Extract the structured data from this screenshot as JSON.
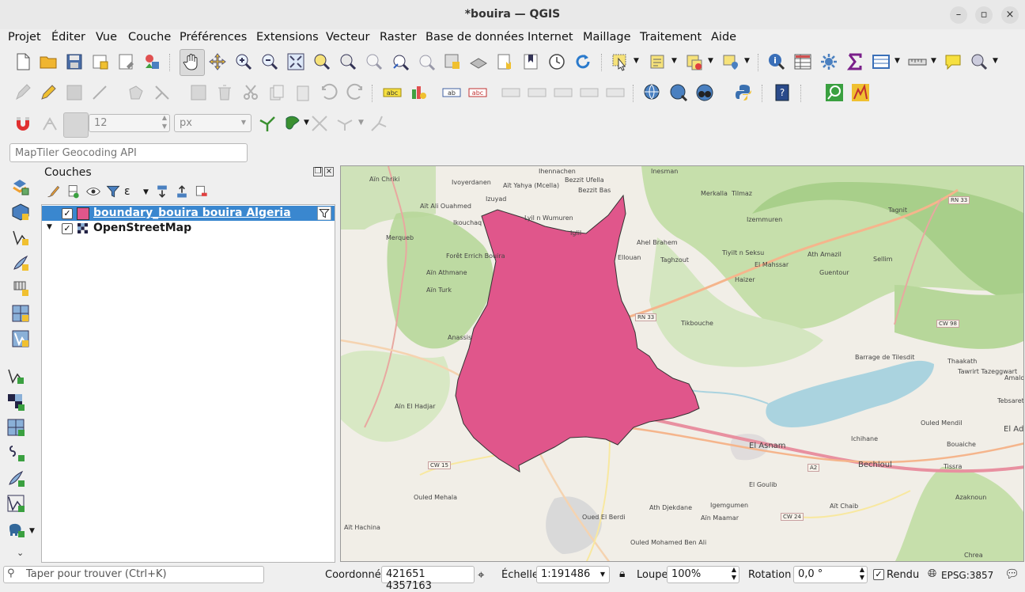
{
  "window": {
    "title": "*bouira — QGIS"
  },
  "menu": [
    "Projet",
    "Éditer",
    "Vue",
    "Couche",
    "Préférences",
    "Extensions",
    "Vecteur",
    "Raster",
    "Base de données",
    "Internet",
    "Maillage",
    "Traitement",
    "Aide"
  ],
  "snapping": {
    "tolerance": "12",
    "unit": "px"
  },
  "locator_toolbar": {
    "placeholder": "MapTiler Geocoding API"
  },
  "layers_panel": {
    "title": "Couches",
    "layers": [
      {
        "name": "boundary_bouira bouira Algeria",
        "checked": true,
        "selected": true,
        "color": "#e0568b"
      },
      {
        "name": "OpenStreetMap",
        "checked": true,
        "selected": false
      }
    ]
  },
  "map": {
    "polygon_fill": "#e0568b",
    "labels": [
      "Ihennachen",
      "Inesman",
      "Aïn Chriki",
      "Ivoyerdanen",
      "Aït Yahya (Mcella)",
      "Bezzit Ufella",
      "Bezzit Bas",
      "Merkalla",
      "Tilmaz",
      "Aït Ali Ouahmed",
      "Izuyad",
      "Lyil n Wumuren",
      "Ikouchaq",
      "Iglil",
      "Merqueb",
      "Izemmuren",
      "Tagnit",
      "Ahel Brahem",
      "Tiyilt n Seksu",
      "Ellouan",
      "Taghzout",
      "El Mahssar",
      "Ath Amazil",
      "Sellim",
      "Forêt Errich Bouira",
      "Aïn Athmane",
      "Guentour",
      "Haizer",
      "Aïn Turk",
      "Tikbouche",
      "Anassis",
      "Thaakath",
      "Tawrirt Tazeggwart",
      "Amalou",
      "Barrage de Tilesdit",
      "Aïn El Hadjar",
      "Tebsaret",
      "Ouled Mendil",
      "Ichihane",
      "El Adj",
      "El Asnam",
      "Bouaiche",
      "Bechloul",
      "Tissra",
      "Ouled Mehala",
      "El Goulib",
      "Azaknoun",
      "Ath Djekdane",
      "Igemgumen",
      "Aïn Maamar",
      "Aït Chaib",
      "Oued El Berdi",
      "Ouled Mohamed Ben Ali",
      "Aït Hachina",
      "Chrea"
    ],
    "road_shields": [
      "RN 33",
      "RN 33",
      "CW 98",
      "CW 15",
      "A2",
      "CW 24"
    ]
  },
  "statusbar": {
    "search_placeholder": "Taper pour trouver (Ctrl+K)",
    "coord_label": "Coordonnée",
    "coord_value": "421651  4357163",
    "scale_label": "Échelle",
    "scale_value": "1:191486",
    "magnifier_label": "Loupe",
    "magnifier_value": "100%",
    "rotation_label": "Rotation",
    "rotation_value": "0,0 °",
    "render_label": "Rendu",
    "crs": "EPSG:3857"
  }
}
